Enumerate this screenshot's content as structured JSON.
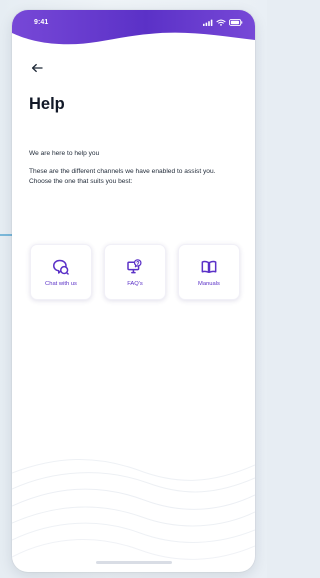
{
  "status_bar": {
    "time": "9:41"
  },
  "header": {
    "back_icon": "arrow-left-icon",
    "title": "Help"
  },
  "intro_text": "We are here to help you",
  "description_text": "These are the different channels we have enabled to assist you. Choose the one that suits you best:",
  "channels": [
    {
      "label": "Chat with us",
      "icon": "chat-bubbles-icon"
    },
    {
      "label": "FAQ's",
      "icon": "monitor-chat-icon"
    },
    {
      "label": "Manuals",
      "icon": "book-icon"
    }
  ],
  "colors": {
    "header_purple": "#5b31c7",
    "header_violet": "#7748d7",
    "card_text": "#5b31c7"
  }
}
